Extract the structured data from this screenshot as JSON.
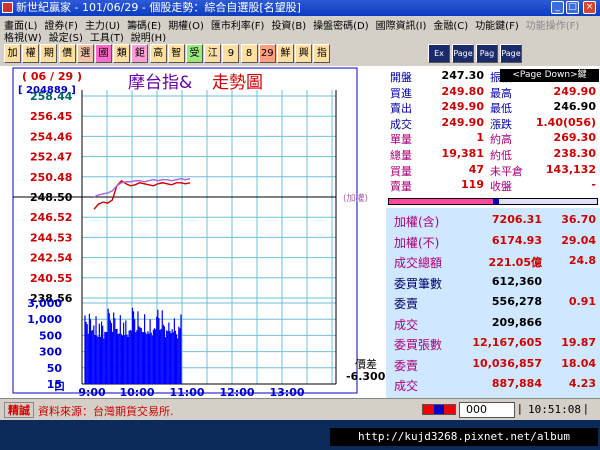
{
  "window": {
    "title": "新世紀贏家 - 101/06/29 - 個股走勢：綜合自選股[名望股]"
  },
  "menu": {
    "row1": [
      "畫面(L)",
      "證券(F)",
      "主力(U)",
      "籌碼(E)",
      "期權(O)",
      "匯市利率(F)",
      "投資(B)",
      "操盤密碼(D)",
      "國際資訊(I)",
      "金融(C)",
      "功能鍵(F)",
      "功能操作(F)"
    ],
    "row2": [
      "格視(W)",
      "設定(S)",
      "工具(T)",
      "說明(H)"
    ]
  },
  "toolbar": {
    "buttons": [
      "加",
      "權",
      "期",
      "價",
      "選",
      "國",
      "類",
      "鉅",
      "高",
      "智",
      "受",
      "江",
      "9",
      "8",
      "29",
      "鮮",
      "興",
      "指"
    ],
    "icons": [
      "Ex",
      "Page",
      "Pag",
      "Page"
    ]
  },
  "chart": {
    "date": "( 06 / 29 )",
    "code": "[ 204889 ]",
    "title_left": "摩台指&",
    "title_right": "走勢圖",
    "index_label": "(加權)",
    "spread_label": "價差",
    "spread_value": "-6.300",
    "volume_unit": "口",
    "axis_color": "#0000cc",
    "up_color": "#cc0000",
    "down_color": "#006600"
  },
  "chart_data": {
    "type": "line",
    "price_axis": [
      "258.44",
      "256.45",
      "254.46",
      "252.47",
      "250.48",
      "248.50",
      "246.52",
      "244.53",
      "242.54",
      "240.55",
      "238.56"
    ],
    "ylim": [
      238.56,
      258.44
    ],
    "reference": 248.5,
    "volume_axis": [
      "3,000",
      "1,000",
      "500",
      "300",
      "50",
      "15"
    ],
    "time_ticks": [
      "9:00",
      "10:00",
      "11:00",
      "12:00",
      "13:00"
    ],
    "series": [
      {
        "values": [
          247.3,
          247.8,
          248.0,
          247.9,
          248.2,
          249.6,
          250.1,
          249.8,
          249.6,
          249.7,
          249.9,
          249.8,
          249.7,
          249.6,
          249.8,
          249.9,
          249.8,
          249.7,
          249.9,
          249.9,
          249.8,
          249.9
        ]
      },
      {
        "values": [
          248.5,
          248.7,
          248.8,
          248.9,
          249.1,
          249.6,
          249.9,
          250.0,
          250.0,
          250.1,
          250.1,
          250.0,
          250.1,
          250.2,
          250.1,
          250.2,
          250.2,
          250.1,
          250.2,
          250.3,
          250.2,
          250.3
        ]
      }
    ],
    "volume": [
      2200,
      700,
      400,
      300,
      1400,
      600,
      350,
      250,
      300,
      200,
      900,
      250,
      150,
      400,
      200,
      600,
      300,
      150,
      200,
      400,
      250,
      1800
    ]
  },
  "quote": {
    "rows": [
      {
        "l1": "開盤",
        "v1": "247.30",
        "l2": "振幅",
        "v2": "%"
      },
      {
        "l1": "買進",
        "v1": "249.80",
        "l2": "最高",
        "v2": "249.90"
      },
      {
        "l1": "賣出",
        "v1": "249.90",
        "l2": "最低",
        "v2": "246.90"
      },
      {
        "l1": "成交",
        "v1": "249.90",
        "l2": "漲跌",
        "v2": "1.40(056)"
      },
      {
        "l1": "單量",
        "v1": "1",
        "l2": "約高",
        "v2": "269.30"
      },
      {
        "l1": "總量",
        "v1": "19,381",
        "l2": "約低",
        "v2": "238.30"
      },
      {
        "l1": "買量",
        "v1": "47",
        "l2": "未平倉",
        "v2": "143,132"
      },
      {
        "l1": "賣量",
        "v1": "119",
        "l2": "收盤",
        "v2": "-"
      }
    ],
    "tooltip": "<Page Down>鍵"
  },
  "market": {
    "rows": [
      {
        "label": "加權(含)",
        "value": "7206.31",
        "change": "36.70"
      },
      {
        "label": "加權(不)",
        "value": "6174.93",
        "change": "29.04"
      },
      {
        "label": "成交總額",
        "value": "221.05億",
        "change": "24.8"
      },
      {
        "label": "委買筆數",
        "value": "612,360",
        "change": ""
      },
      {
        "label": "委賣",
        "value": "556,278",
        "change": "0.91"
      },
      {
        "label": "成交",
        "value": "209,866",
        "change": ""
      },
      {
        "label": "委買張數",
        "value": "12,167,605",
        "change": "19.87"
      },
      {
        "label": "委賣",
        "value": "10,036,857",
        "change": "18.04"
      },
      {
        "label": "成交",
        "value": "887,884",
        "change": "4.23"
      }
    ]
  },
  "status": {
    "tag": "精誠",
    "source": "資料來源：台灣期貨交易所.",
    "input": "000",
    "time": "10:51:08"
  },
  "footer": {
    "url": "http://kujd3268.pixnet.net/album"
  }
}
